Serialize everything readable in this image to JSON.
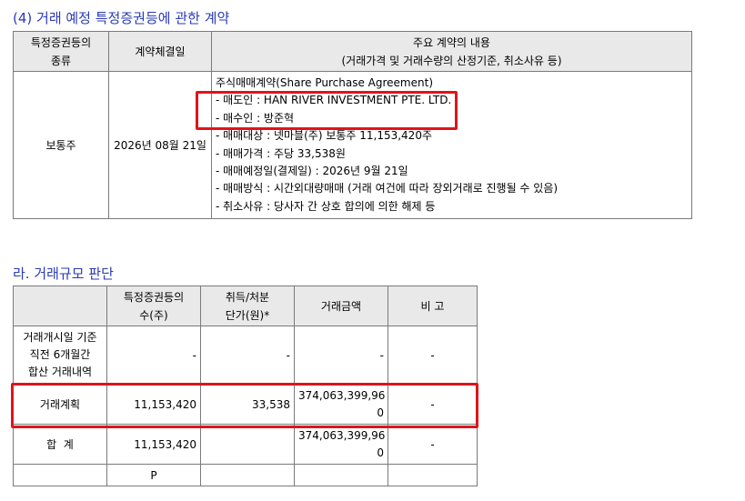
{
  "section1": {
    "title": "(4) 거래 예정 특정증권등에 관한 계약",
    "headers": {
      "col1": "특정증권등의\n종류",
      "col2": "계약체결일",
      "col3_line1": "주요 계약의 내용",
      "col3_line2": "(거래가격 및 거래수량의 산정기준, 취소사유 등)"
    },
    "row": {
      "type": "보통주",
      "date": "2026년 08월 21일",
      "lines": [
        "주식매매계약(Share Purchase Agreement)",
        "- 매도인 : HAN RIVER INVESTMENT PTE. LTD.",
        "- 매수인 : 방준혁",
        "- 매매대상 : 넷마블(주) 보통주 11,153,420주",
        "- 매매가격 : 주당 33,538원",
        "- 매매예정일(결제일) : 2026년 9월 21일",
        "- 매매방식 : 시간외대량매매 (거래 여건에 따라 장외거래로 진행될 수 있음)",
        "- 취소사유 : 당사자 간 상호 합의에 의한 해제 등"
      ]
    }
  },
  "section2": {
    "title": "라. 거래규모 판단",
    "headers": {
      "h1": "특정증권등의\n수(주)",
      "h2": "취득/처분\n단가(원)*",
      "h3": "거래금액",
      "h4": "비 고"
    },
    "rows": [
      {
        "label": "거래개시일 기준\n직전 6개월간\n합산 거래내역",
        "qty": "-",
        "price": "-",
        "amount": "-",
        "note": "-"
      },
      {
        "label": "거래계획",
        "qty": "11,153,420",
        "price": "33,538",
        "amount": "374,063,399,96\n0",
        "note": "-"
      },
      {
        "label": "합  계",
        "qty": "11,153,420",
        "price": "",
        "amount": "374,063,399,96\n0",
        "note": "-"
      },
      {
        "label": "",
        "qty": "P",
        "price": "",
        "amount": "",
        "note": ""
      }
    ]
  },
  "highlight_color": "#e0141b"
}
